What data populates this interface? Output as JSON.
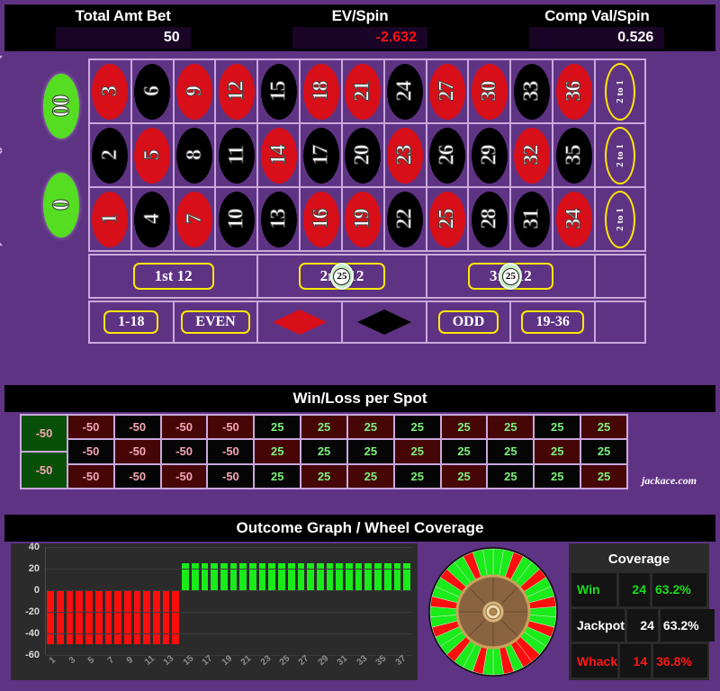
{
  "header": {
    "stats": [
      {
        "title": "Total Amt Bet",
        "value": "50",
        "negative": false
      },
      {
        "title": "EV/Spin",
        "value": "-2.632",
        "negative": true
      },
      {
        "title": "Comp Val/Spin",
        "value": "0.526",
        "negative": false
      }
    ]
  },
  "table": {
    "zeros": [
      {
        "label": "00",
        "color": "green"
      },
      {
        "label": "0",
        "color": "green"
      }
    ],
    "rows": [
      {
        "numbers": [
          {
            "label": "3",
            "color": "red"
          },
          {
            "label": "6",
            "color": "black"
          },
          {
            "label": "9",
            "color": "red"
          },
          {
            "label": "12",
            "color": "red"
          },
          {
            "label": "15",
            "color": "black"
          },
          {
            "label": "18",
            "color": "red"
          },
          {
            "label": "21",
            "color": "red"
          },
          {
            "label": "24",
            "color": "black"
          },
          {
            "label": "27",
            "color": "red"
          },
          {
            "label": "30",
            "color": "red"
          },
          {
            "label": "33",
            "color": "black"
          },
          {
            "label": "36",
            "color": "red"
          }
        ],
        "column_bet": "2 to 1"
      },
      {
        "numbers": [
          {
            "label": "2",
            "color": "black"
          },
          {
            "label": "5",
            "color": "red"
          },
          {
            "label": "8",
            "color": "black"
          },
          {
            "label": "11",
            "color": "black"
          },
          {
            "label": "14",
            "color": "red"
          },
          {
            "label": "17",
            "color": "black"
          },
          {
            "label": "20",
            "color": "black"
          },
          {
            "label": "23",
            "color": "red"
          },
          {
            "label": "26",
            "color": "black"
          },
          {
            "label": "29",
            "color": "black"
          },
          {
            "label": "32",
            "color": "red"
          },
          {
            "label": "35",
            "color": "black"
          }
        ],
        "column_bet": "2 to 1"
      },
      {
        "numbers": [
          {
            "label": "1",
            "color": "red"
          },
          {
            "label": "4",
            "color": "black"
          },
          {
            "label": "7",
            "color": "red"
          },
          {
            "label": "10",
            "color": "black"
          },
          {
            "label": "13",
            "color": "black"
          },
          {
            "label": "16",
            "color": "red"
          },
          {
            "label": "19",
            "color": "red"
          },
          {
            "label": "22",
            "color": "black"
          },
          {
            "label": "25",
            "color": "red"
          },
          {
            "label": "28",
            "color": "black"
          },
          {
            "label": "31",
            "color": "black"
          },
          {
            "label": "34",
            "color": "red"
          }
        ],
        "column_bet": "2 to 1"
      }
    ],
    "dozens": [
      {
        "label": "1st 12",
        "chip": null
      },
      {
        "label": "2nd 12",
        "chip": "25"
      },
      {
        "label": "3rd 12",
        "chip": "25"
      }
    ],
    "outside": [
      {
        "label": "1-18",
        "kind": "pill"
      },
      {
        "label": "EVEN",
        "kind": "pill"
      },
      {
        "label": "",
        "kind": "diamond-red"
      },
      {
        "label": "",
        "kind": "diamond-black"
      },
      {
        "label": "ODD",
        "kind": "pill"
      },
      {
        "label": "19-36",
        "kind": "pill"
      }
    ]
  },
  "winloss": {
    "title": "Win/Loss per Spot",
    "watermark": "jackace.com",
    "zeros": [
      {
        "value": "-50",
        "bg": "green"
      },
      {
        "value": "-50",
        "bg": "green"
      }
    ],
    "rows": [
      [
        {
          "value": "-50",
          "bg": "red"
        },
        {
          "value": "-50",
          "bg": "black"
        },
        {
          "value": "-50",
          "bg": "red"
        },
        {
          "value": "-50",
          "bg": "red"
        },
        {
          "value": "25",
          "bg": "black"
        },
        {
          "value": "25",
          "bg": "red"
        },
        {
          "value": "25",
          "bg": "red"
        },
        {
          "value": "25",
          "bg": "black"
        },
        {
          "value": "25",
          "bg": "red"
        },
        {
          "value": "25",
          "bg": "red"
        },
        {
          "value": "25",
          "bg": "black"
        },
        {
          "value": "25",
          "bg": "red"
        }
      ],
      [
        {
          "value": "-50",
          "bg": "black"
        },
        {
          "value": "-50",
          "bg": "red"
        },
        {
          "value": "-50",
          "bg": "black"
        },
        {
          "value": "-50",
          "bg": "black"
        },
        {
          "value": "25",
          "bg": "red"
        },
        {
          "value": "25",
          "bg": "black"
        },
        {
          "value": "25",
          "bg": "black"
        },
        {
          "value": "25",
          "bg": "red"
        },
        {
          "value": "25",
          "bg": "black"
        },
        {
          "value": "25",
          "bg": "black"
        },
        {
          "value": "25",
          "bg": "red"
        },
        {
          "value": "25",
          "bg": "black"
        }
      ],
      [
        {
          "value": "-50",
          "bg": "red"
        },
        {
          "value": "-50",
          "bg": "black"
        },
        {
          "value": "-50",
          "bg": "red"
        },
        {
          "value": "-50",
          "bg": "black"
        },
        {
          "value": "25",
          "bg": "black"
        },
        {
          "value": "25",
          "bg": "red"
        },
        {
          "value": "25",
          "bg": "red"
        },
        {
          "value": "25",
          "bg": "black"
        },
        {
          "value": "25",
          "bg": "red"
        },
        {
          "value": "25",
          "bg": "black"
        },
        {
          "value": "25",
          "bg": "black"
        },
        {
          "value": "25",
          "bg": "red"
        }
      ]
    ]
  },
  "outcome": {
    "title": "Outcome Graph / Wheel Coverage"
  },
  "chart_data": {
    "type": "bar",
    "title": "Outcome Graph / Wheel Coverage",
    "xlabel": "",
    "ylabel": "",
    "ylim": [
      -60,
      40
    ],
    "yticks": [
      40,
      20,
      0,
      -20,
      -40,
      -60
    ],
    "grid": true,
    "legend": "none",
    "x": [
      1,
      2,
      3,
      4,
      5,
      6,
      7,
      8,
      9,
      10,
      11,
      12,
      13,
      14,
      15,
      16,
      17,
      18,
      19,
      20,
      21,
      22,
      23,
      24,
      25,
      26,
      27,
      28,
      29,
      30,
      31,
      32,
      33,
      34,
      35,
      36,
      37,
      38
    ],
    "xtick_labels": [
      "1",
      "3",
      "5",
      "7",
      "9",
      "11",
      "13",
      "15",
      "17",
      "19",
      "21",
      "23",
      "25",
      "27",
      "29",
      "31",
      "33",
      "35",
      "37"
    ],
    "values": [
      -50,
      -50,
      -50,
      -50,
      -50,
      -50,
      -50,
      -50,
      -50,
      -50,
      -50,
      -50,
      -50,
      -50,
      25,
      25,
      25,
      25,
      25,
      25,
      25,
      25,
      25,
      25,
      25,
      25,
      25,
      25,
      25,
      25,
      25,
      25,
      25,
      25,
      25,
      25,
      25,
      25
    ],
    "bar_colors": [
      "#ff0e0e",
      "#1aeb1a"
    ],
    "negative_count": 14,
    "positive_count": 24
  },
  "coverage": {
    "title": "Coverage",
    "rows": [
      {
        "label": "Win",
        "count": "24",
        "pct": "63.2%",
        "color": "#16e016"
      },
      {
        "label": "Jackpot",
        "count": "24",
        "pct": "63.2%",
        "color": "#ffffff"
      },
      {
        "label": "Whack",
        "count": "14",
        "pct": "36.8%",
        "color": "#ff1818"
      }
    ]
  },
  "wheel": {
    "segments": 38,
    "win_color": "#1aeb1a",
    "lose_color": "#ff0e0e",
    "hub_color": "#8a6440"
  }
}
